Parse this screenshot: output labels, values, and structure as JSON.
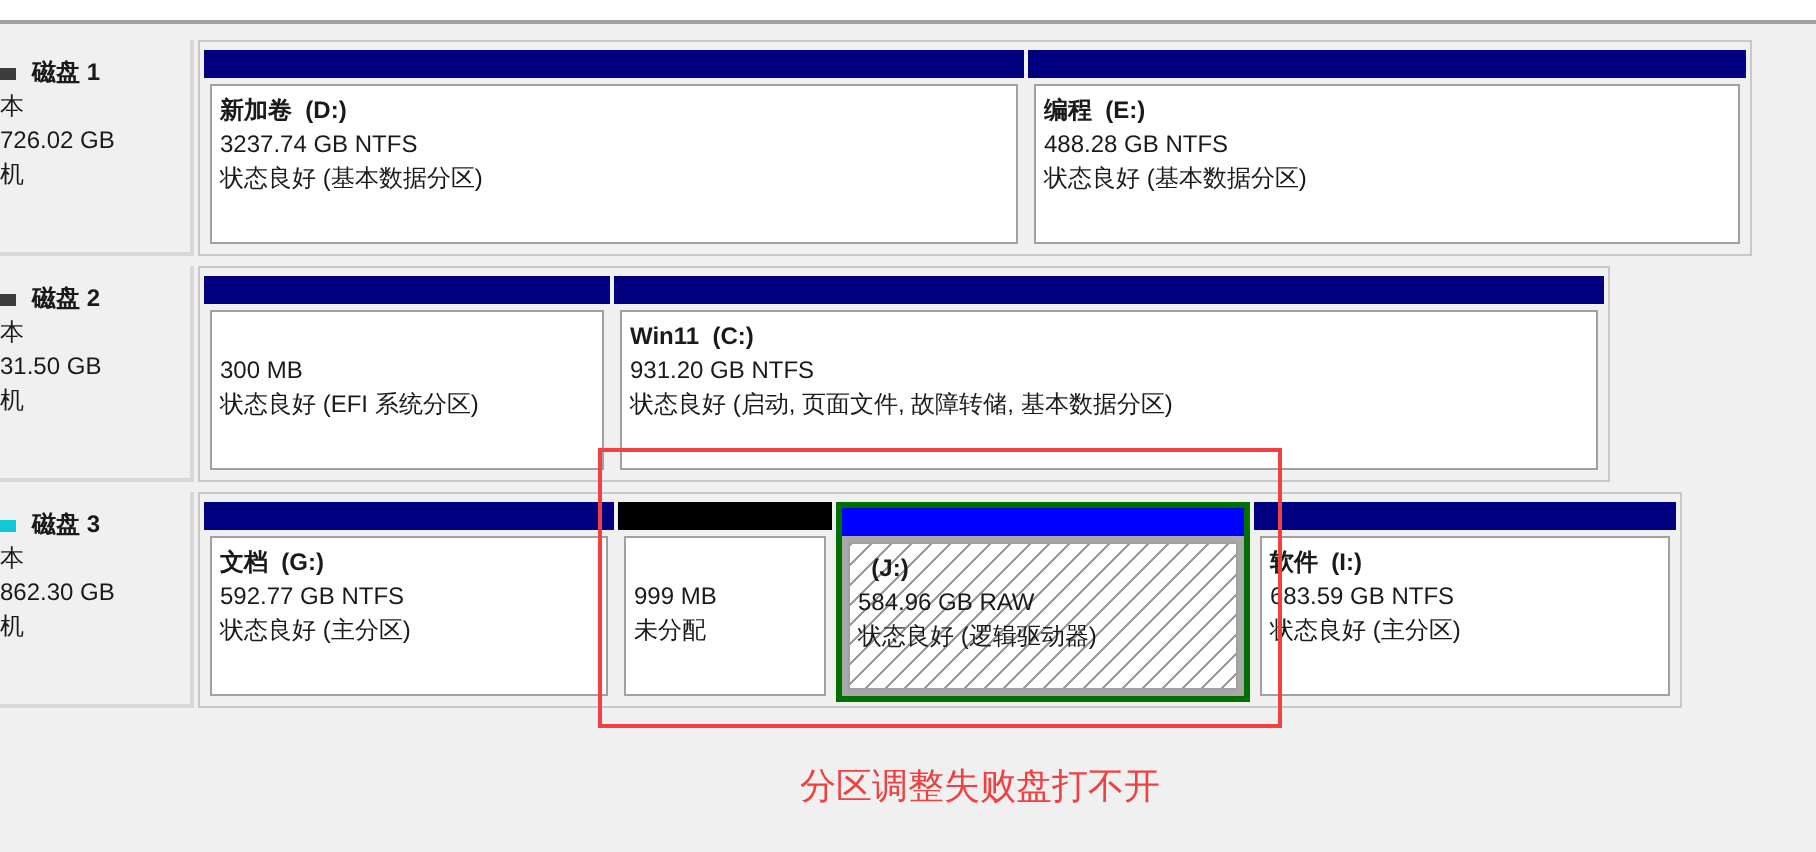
{
  "disks": [
    {
      "name": "磁盘 1",
      "type": "本",
      "size": "726.02 GB",
      "status": "机",
      "color": "#3c3c3c",
      "partitions": [
        {
          "kind": "primary",
          "selected": false,
          "name": "新加卷  (D:)",
          "size": "3237.74 GB NTFS",
          "status": "状态良好 (基本数据分区)"
        },
        {
          "kind": "primary",
          "selected": false,
          "name": "编程  (E:)",
          "size": "488.28 GB NTFS",
          "status": "状态良好 (基本数据分区)"
        }
      ]
    },
    {
      "name": "磁盘 2",
      "type": "本",
      "size": "31.50 GB",
      "status": "机",
      "color": "#3c3c3c",
      "partitions": [
        {
          "kind": "primary",
          "selected": false,
          "size": "300 MB",
          "status": "状态良好 (EFI 系统分区)"
        },
        {
          "kind": "primary",
          "selected": false,
          "name": "Win11  (C:)",
          "size": "931.20 GB NTFS",
          "status": "状态良好 (启动, 页面文件, 故障转储, 基本数据分区)"
        }
      ]
    },
    {
      "name": "磁盘 3",
      "type": "本",
      "size": "862.30 GB",
      "status": "机",
      "color": "#10c8d8",
      "partitions": [
        {
          "kind": "primary",
          "selected": false,
          "name": "文档  (G:)",
          "size": "592.77 GB NTFS",
          "status": "状态良好 (主分区)"
        },
        {
          "kind": "unallocated",
          "selected": false,
          "size": "999 MB",
          "status": "未分配"
        },
        {
          "kind": "logical",
          "selected": true,
          "name": "  (J:)",
          "size": "584.96 GB RAW",
          "status": "状态良好 (逻辑驱动器)"
        },
        {
          "kind": "primary",
          "selected": false,
          "name": "软件  (I:)",
          "size": "683.59 GB NTFS",
          "status": "状态良好 (主分区)"
        }
      ]
    }
  ],
  "annotation": "分区调整失败盘打不开"
}
